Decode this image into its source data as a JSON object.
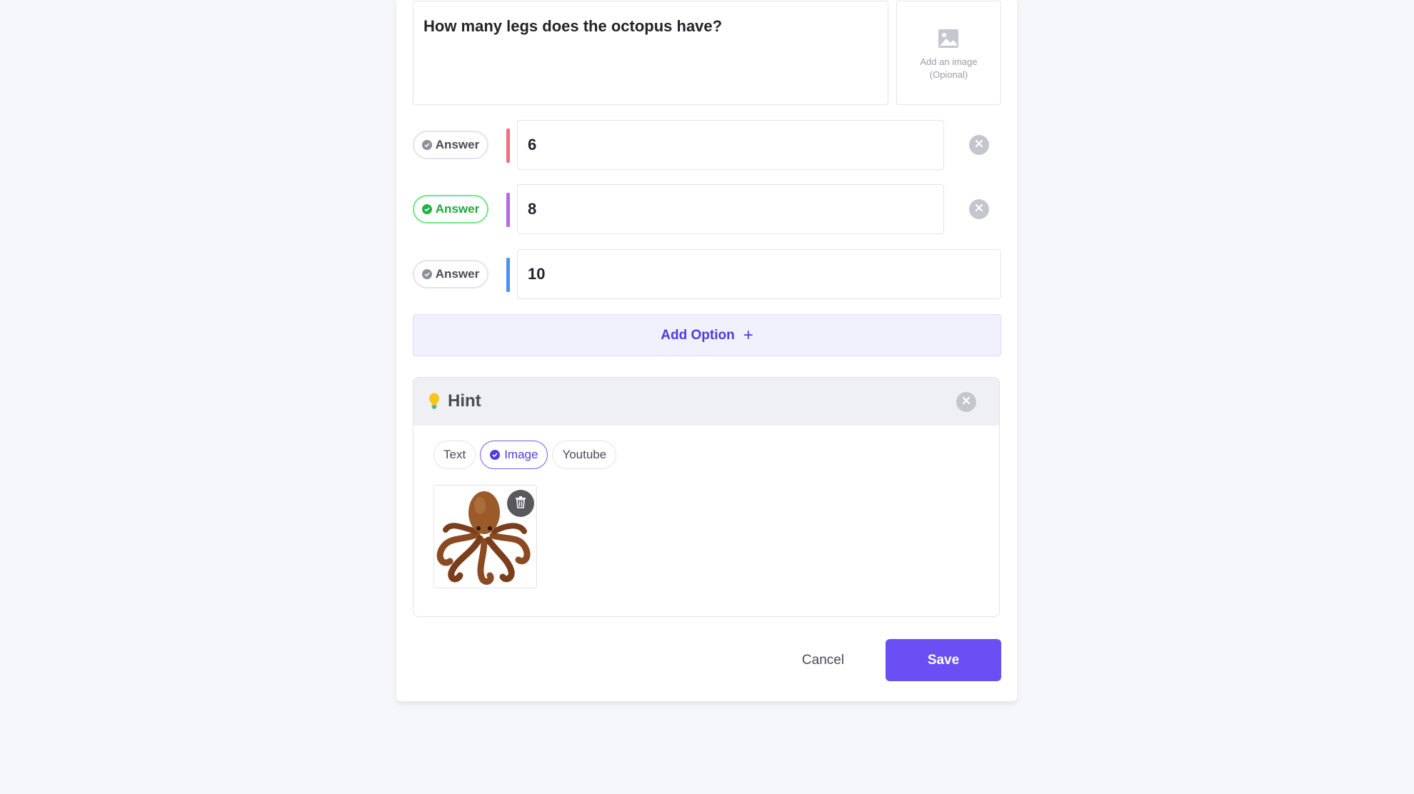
{
  "question": {
    "text": "How many legs does the octopus have?",
    "image_upload_label_line1": "Add an image",
    "image_upload_label_line2": "(Opional)"
  },
  "options": [
    {
      "pill_label": "Answer",
      "value": "6",
      "correct": false,
      "color": "#f0707c",
      "removable": true
    },
    {
      "pill_label": "Answer",
      "value": "8",
      "correct": true,
      "color": "#b36be0",
      "removable": true
    },
    {
      "pill_label": "Answer",
      "value": "10",
      "correct": false,
      "color": "#4f8ff0",
      "removable": false
    }
  ],
  "add_option": {
    "label": "Add Option",
    "plus": "+"
  },
  "hint": {
    "title": "Hint",
    "tabs": [
      {
        "label": "Text",
        "active": false
      },
      {
        "label": "Image",
        "active": true
      },
      {
        "label": "Youtube",
        "active": false
      }
    ],
    "image_icon": "octopus-illustration"
  },
  "footer": {
    "cancel_label": "Cancel",
    "save_label": "Save"
  },
  "colors": {
    "accent": "#6b4ff5",
    "accent_text": "#4d3de0",
    "correct_green": "#1fb346",
    "bar_red": "#f0707c",
    "bar_purple": "#b36be0",
    "bar_blue": "#4f8ff0"
  }
}
